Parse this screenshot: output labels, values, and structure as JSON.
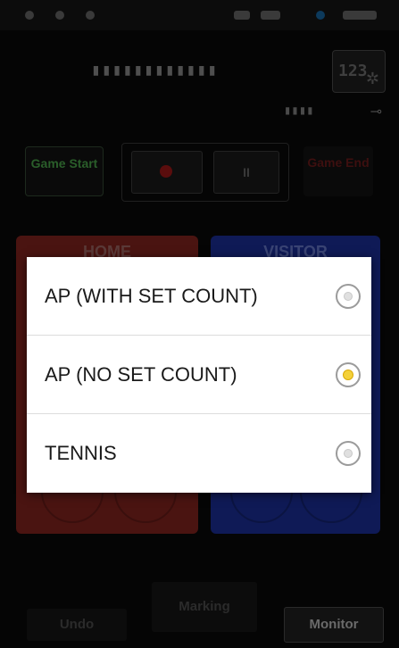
{
  "background_screen": {
    "title_masked": "▮▮▮▮▮▮▮▮▮▮▮▮",
    "settings_glyph": "123",
    "battery_masked": "▮▮▮▮",
    "controls": {
      "game_start_label": "Game Start",
      "pause_glyph": "II",
      "game_end_label": "Game End"
    },
    "home_label": "HOME",
    "visitor_label": "VISITOR",
    "undo_label": "Undo",
    "marking_label": "Marking",
    "monitor_label": "Monitor"
  },
  "dialog": {
    "options": [
      {
        "label": "AP (WITH SET COUNT)",
        "selected": false
      },
      {
        "label": "AP (NO SET COUNT)",
        "selected": true
      },
      {
        "label": "TENNIS",
        "selected": false
      }
    ]
  },
  "colors": {
    "selected_radio": "#f4d13a",
    "home_panel": "#4a1411",
    "visitor_panel": "#0f1a56"
  }
}
